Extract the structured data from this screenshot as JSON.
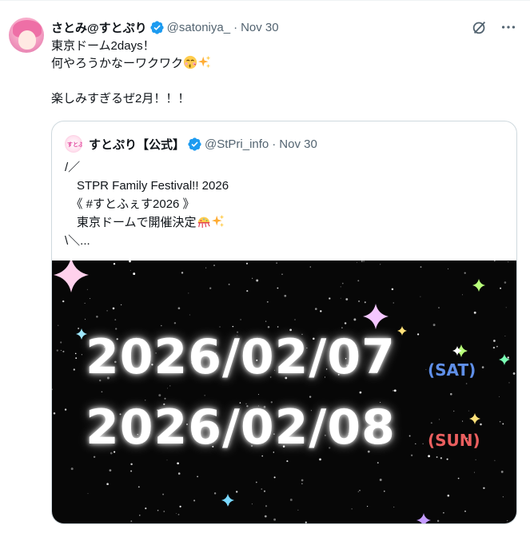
{
  "tweet": {
    "author_name": "さとみ@すとぷり",
    "handle": "@satoniya_",
    "separator": "·",
    "time": "Nov 30",
    "line1": "東京ドーム2days！",
    "line2": "何やろうかなーワクワク",
    "line3": "楽しみすぎるぜ2月！！！",
    "actions": {
      "grok_icon": "grok-icon",
      "more_icon": "more-icon"
    }
  },
  "quote": {
    "author_name": "すとぷり【公式】",
    "avatar_text": "すとぷり",
    "handle": "@StPri_info",
    "separator": "·",
    "time": "Nov 30",
    "line1": "/／",
    "line2": "　STPR Family Festival!! 2026",
    "line3": "　《 #すとふぇす2026 》",
    "line4": "　東京ドームで開催決定",
    "line5": "\\＼...",
    "media": {
      "date1": "2026/02/07",
      "day1": "(SAT)",
      "date2": "2026/02/08",
      "day2": "(SUN)",
      "colors": {
        "day1": "#5f8fe8",
        "day2": "#ea5f5f",
        "background": "#070707"
      }
    }
  },
  "colors": {
    "verified": "#1d9bf0",
    "muted": "#536471",
    "border": "#cfd9de"
  }
}
